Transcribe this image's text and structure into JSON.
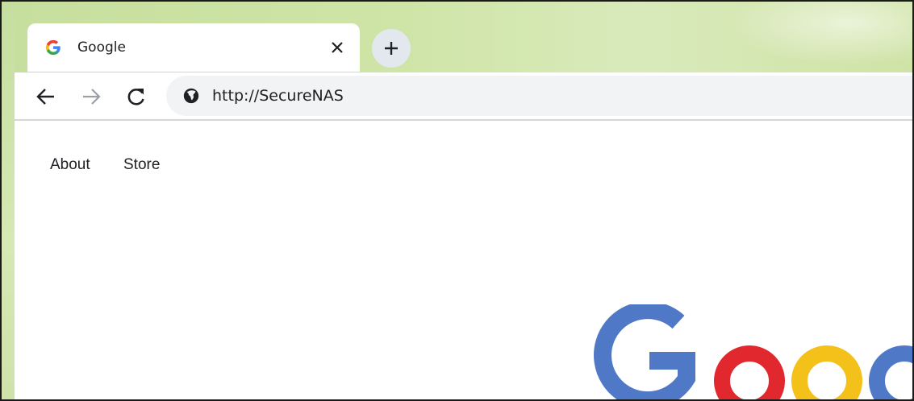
{
  "browser": {
    "tab": {
      "title": "Google",
      "favicon": "google-g-icon",
      "close_icon": "close-icon"
    },
    "new_tab_icon": "plus-icon",
    "toolbar": {
      "back_icon": "arrow-left-icon",
      "forward_icon": "arrow-right-icon",
      "reload_icon": "reload-icon",
      "site_icon": "globe-icon",
      "url": "http://SecureNAS"
    },
    "theme_color": "#c9e0a2"
  },
  "page": {
    "nav_links": [
      "About",
      "Store"
    ],
    "logo_text": "Google",
    "logo_colors": [
      "#4285f4",
      "#ea4335",
      "#fbbc05",
      "#4285f4"
    ]
  }
}
